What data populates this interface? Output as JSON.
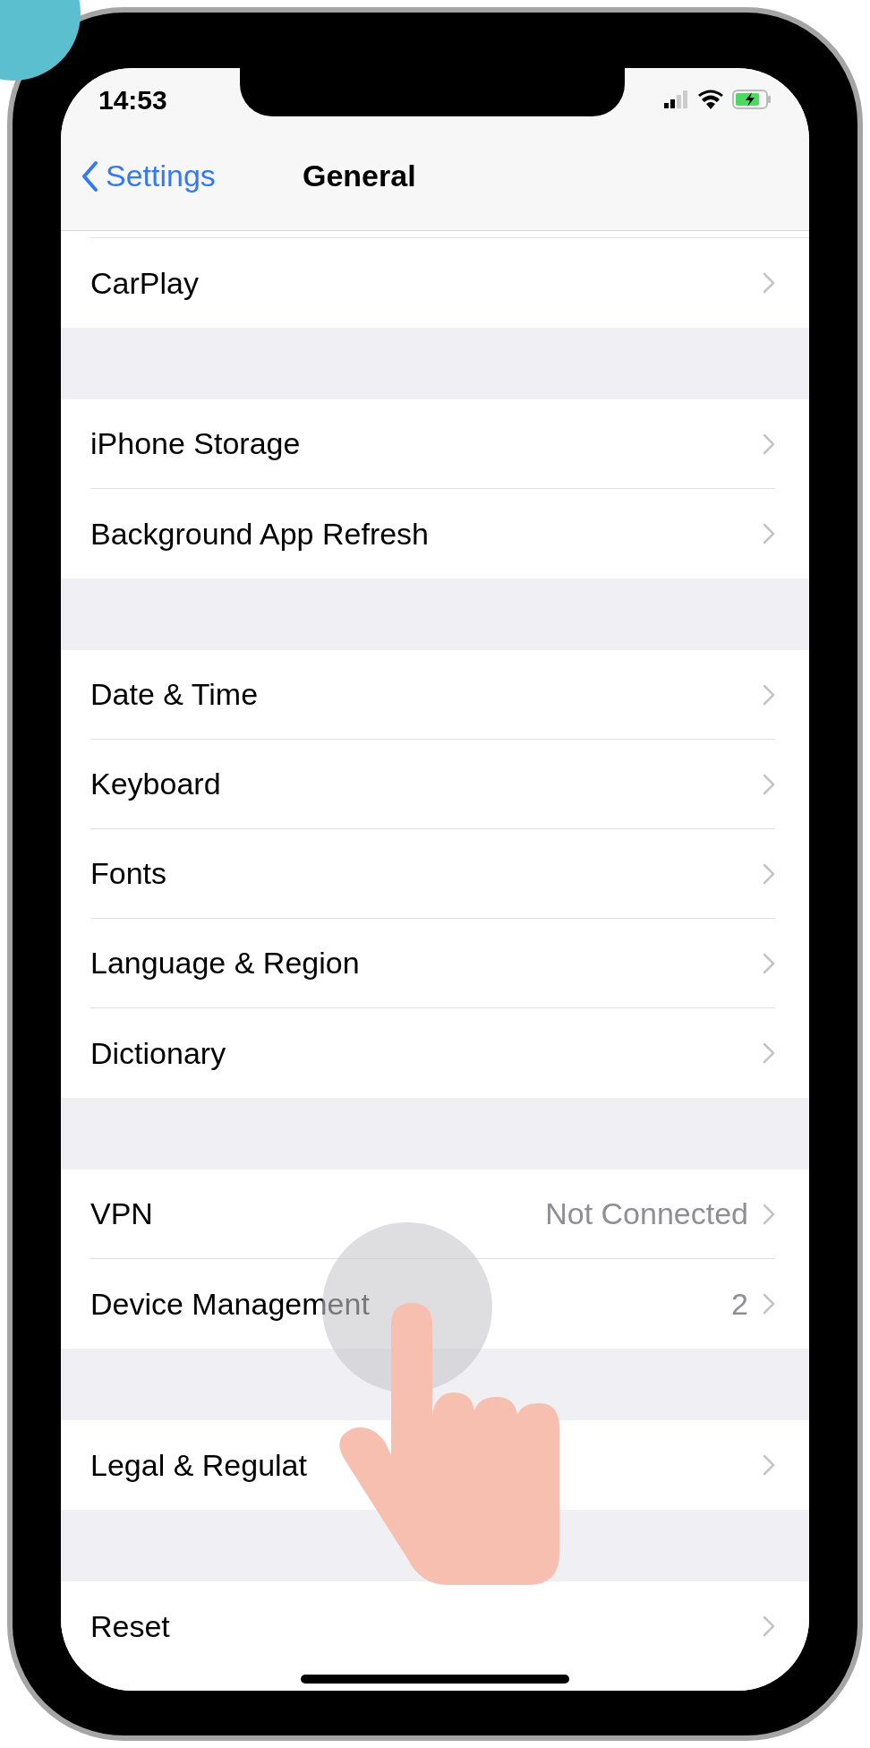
{
  "status_bar": {
    "time": "14:53"
  },
  "nav": {
    "back": "Settings",
    "title": "General"
  },
  "groups": [
    {
      "rows": [
        {
          "label": "CarPlay"
        }
      ]
    },
    {
      "rows": [
        {
          "label": "iPhone Storage"
        },
        {
          "label": "Background App Refresh"
        }
      ]
    },
    {
      "rows": [
        {
          "label": "Date & Time"
        },
        {
          "label": "Keyboard"
        },
        {
          "label": "Fonts"
        },
        {
          "label": "Language & Region"
        },
        {
          "label": "Dictionary"
        }
      ]
    },
    {
      "rows": [
        {
          "label": "VPN",
          "value": "Not Connected"
        },
        {
          "label": "Device Management",
          "value": "2"
        }
      ]
    },
    {
      "rows": [
        {
          "label": "Legal & Regulat"
        }
      ]
    },
    {
      "rows": [
        {
          "label": "Reset"
        }
      ]
    }
  ]
}
